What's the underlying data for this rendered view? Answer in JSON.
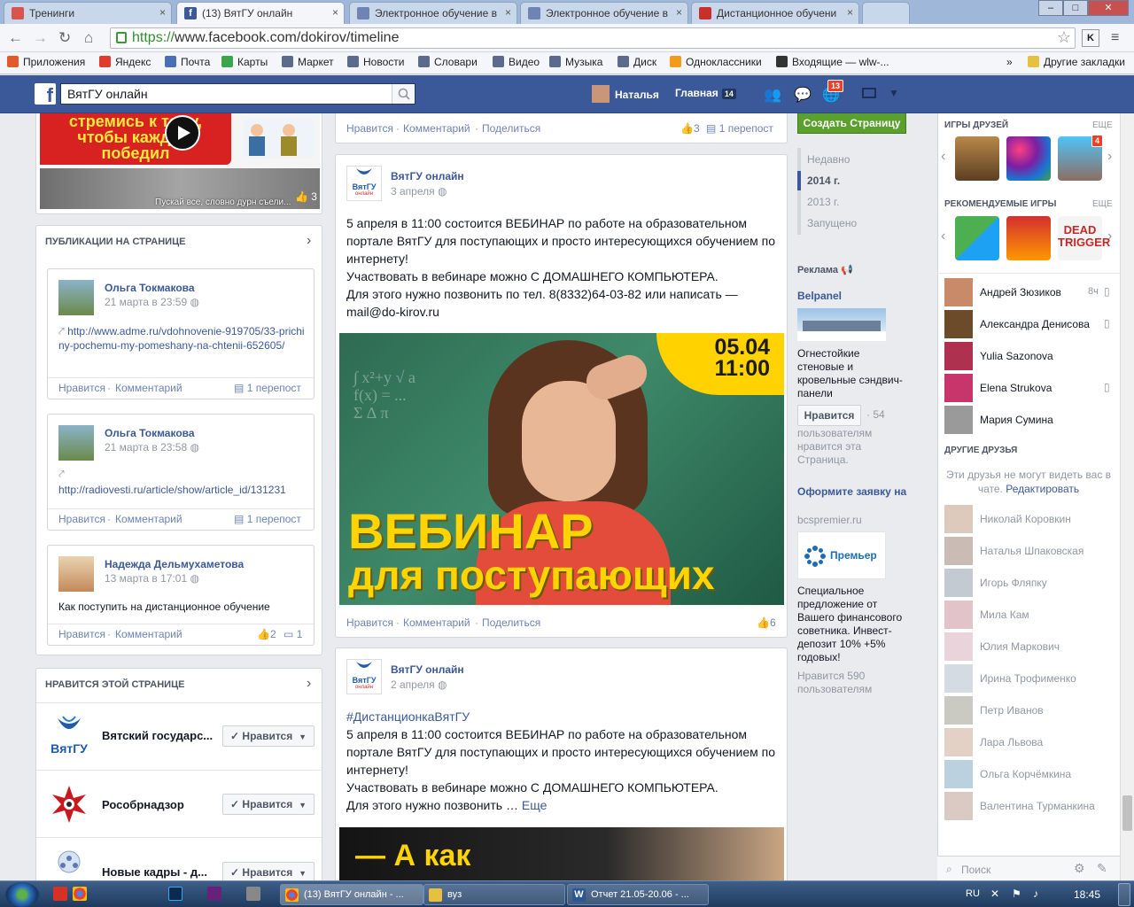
{
  "browser": {
    "tabs": [
      {
        "title": "Тренинги",
        "color": "#d9534f"
      },
      {
        "title": "(13) ВятГУ онлайн",
        "color": "#3b5998"
      },
      {
        "title": "Электронное обучение в",
        "color": "#6d84b4"
      },
      {
        "title": "Электронное обучение в",
        "color": "#6d84b4"
      },
      {
        "title": "Дистанционное обучени",
        "color": "#c9302c"
      }
    ],
    "url_https": "https://",
    "url_rest": "www.facebook.com/dokirov/timeline",
    "bookmarks": [
      {
        "label": "Приложения",
        "color": "#e25a2b"
      },
      {
        "label": "Яндекс",
        "color": "#e03b2b"
      },
      {
        "label": "Почта",
        "color": "#4a6fb5"
      },
      {
        "label": "Карты",
        "color": "#3aa64a"
      },
      {
        "label": "Маркет",
        "color": "#5a6b8c"
      },
      {
        "label": "Новости",
        "color": "#5a6b8c"
      },
      {
        "label": "Словари",
        "color": "#5a6b8c"
      },
      {
        "label": "Видео",
        "color": "#5a6b8c"
      },
      {
        "label": "Музыка",
        "color": "#5a6b8c"
      },
      {
        "label": "Диск",
        "color": "#5a6b8c"
      },
      {
        "label": "Одноклассники",
        "color": "#f29a1e"
      },
      {
        "label": "Входящие — wlw-...",
        "color": "#333333"
      }
    ],
    "bookmarks_more": "»",
    "other_bookmarks": "Другие закладки"
  },
  "fb": {
    "search_value": "ВятГУ онлайн",
    "user_name": "Наталья",
    "home_label": "Главная",
    "home_count": "14",
    "notif_count": "13"
  },
  "left": {
    "video_caption": "Пускай все, словно дурн съели...",
    "video_likes": "3",
    "video_banner_lines": [
      "стремись к тому,",
      "чтобы каждый",
      "победил"
    ],
    "pubs_title": "ПУБЛИКАЦИИ НА СТРАНИЦЕ",
    "pubs": [
      {
        "author": "Ольга Токмакова",
        "date": "21 марта в 23:59",
        "link": "http://www.adme.ru/vdohnovenie-919705/33-prichiny-pochemu-my-pomeshany-na-chtenii-652605/",
        "like": "Нравится",
        "comment": "Комментарий",
        "share": "1 перепост"
      },
      {
        "author": "Ольга Токмакова",
        "date": "21 марта в 23:58",
        "link": "http://radiovesti.ru/article/show/article_id/131231",
        "like": "Нравится",
        "comment": "Комментарий",
        "share": "1 перепост"
      },
      {
        "author": "Надежда Дельмухаметова",
        "date": "13 марта в 17:01",
        "text": "Как поступить на дистанционное обучение",
        "like": "Нравится",
        "comment": "Комментарий",
        "likes_count": "2",
        "comments_count": "1"
      }
    ],
    "likes_title": "НРАВИТСЯ ЭТОЙ СТРАНИЦЕ",
    "liked_pages": [
      {
        "name": "Вятский государс...",
        "btn": "Нравится",
        "logo": "ВятГУ"
      },
      {
        "name": "Рособрнадзор",
        "btn": "Нравится"
      },
      {
        "name": "Новые кадры - д...",
        "btn": "Нравится"
      }
    ]
  },
  "feed": {
    "top_actions": {
      "like": "Нравится",
      "comment": "Комментарий",
      "share": "Поделиться",
      "likes": "3",
      "shares": "1 перепост"
    },
    "post1": {
      "author": "ВятГУ онлайн",
      "date": "3 апреля",
      "text": "5 апреля в 11:00 состоится ВЕБИНАР по работе на образовательном портале ВятГУ для поступающих и просто интересующихся обучением по интернету!\nУчаствовать в вебинаре можно С ДОМАШНЕГО КОМПЬЮТЕРА.\nДля этого нужно позвонить по тел. 8(8332)64-03-82 или написать — mail@do-kirov.ru",
      "image_date": "05.04",
      "image_time": "11:00",
      "image_title1": "ВЕБИНАР",
      "image_title2": "для поступающих",
      "like": "Нравится",
      "comment": "Комментарий",
      "share": "Поделиться",
      "likes": "6"
    },
    "post2": {
      "author": "ВятГУ онлайн",
      "date": "2 апреля",
      "hashtag": "#ДистанционкаВятГУ",
      "text": "5 апреля в 11:00 состоится ВЕБИНАР по работе на образовательном портале ВятГУ для поступающих и просто интересующихся обучением по интернету!\nУчаствовать в вебинаре можно С ДОМАШНЕГО КОМПЬЮТЕРА.\nДля этого нужно позвонить …",
      "more": "Еще",
      "image_text": "— А как"
    },
    "logo_text": "ВятГУ",
    "logo_sub": "онлайн"
  },
  "timeline_nav": {
    "create_page": "Создать Страницу",
    "items": [
      "Недавно",
      "2014 г.",
      "2013 г.",
      "Запущено"
    ]
  },
  "ads": {
    "title": "Реклама",
    "ad1": {
      "name": "Belpanel",
      "text": "Огнестойкие стеновые и кровельные сэндвич-панели",
      "btn": "Нравится",
      "count": "· 54",
      "count_text": "пользователям нравится эта Страница."
    },
    "ad2": {
      "name": "Оформите заявку на",
      "domain": "bcspremier.ru",
      "logo": "Премьер",
      "text": "Специальное предложение от Вашего финансового советника. Инвест-депозит 10% +5% годовых!",
      "likes": "Нравится 590 пользователям"
    }
  },
  "sidebar": {
    "games_title": "ИГРЫ ДРУЗЕЙ",
    "more1": "ЕЩЕ",
    "rec_title": "РЕКОМЕНДУЕМЫЕ ИГРЫ",
    "more2": "ЕЩЕ",
    "game_badge": "4",
    "online": [
      {
        "name": "Андрей Зюзиков",
        "status": "8ч"
      },
      {
        "name": "Александра Денисова",
        "status": ""
      },
      {
        "name": "Yulia Sazonova",
        "status": ""
      },
      {
        "name": "Elena Strukova",
        "status": ""
      },
      {
        "name": "Мария Сумина",
        "status": ""
      }
    ],
    "other_title": "ДРУГИЕ ДРУЗЬЯ",
    "other_note": "Эти друзья не могут видеть вас в чате.",
    "other_edit": "Редактировать",
    "offline": [
      "Николай Коровкин",
      "Наталья Шпаковская",
      "Игорь Фляпку",
      "Мила Кам",
      "Юлия Маркович",
      "Ирина Трофименко",
      "Петр Иванов",
      "Лара Львова",
      "Ольга Корчёмкина",
      "Валентина Турманкина"
    ],
    "search_placeholder": "Поиск"
  },
  "taskbar": {
    "items": [
      {
        "label": "(13) ВятГУ онлайн - ...",
        "color": "#e0a030"
      },
      {
        "label": "вуз",
        "color": "#e8c040"
      },
      {
        "label": "Отчет 21.05-20.06 - ...",
        "color": "#2b5797"
      }
    ],
    "lang": "RU",
    "time": "18:45"
  },
  "colors": {
    "fb_blue": "#3b5998",
    "green_btn": "#5aa02c",
    "link": "#3b5998"
  }
}
